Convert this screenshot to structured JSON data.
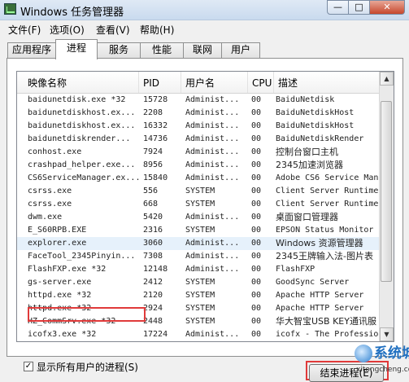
{
  "window": {
    "title": "Windows 任务管理器"
  },
  "titlebar_buttons": {
    "minimize": "—",
    "maximize": "□",
    "close": "✕"
  },
  "menu": [
    "文件(F)",
    "选项(O)",
    "查看(V)",
    "帮助(H)"
  ],
  "tabs": [
    "应用程序",
    "进程",
    "服务",
    "性能",
    "联网",
    "用户"
  ],
  "active_tab": "进程",
  "columns": [
    "映像名称",
    "PID",
    "用户名",
    "CPU",
    "描述"
  ],
  "processes": [
    {
      "name": "baidunetdisk.exe *32",
      "pid": "15728",
      "user": "Administ...",
      "cpu": "00",
      "desc": "BaiduNetdisk"
    },
    {
      "name": "baidunetdiskhost.ex...",
      "pid": "2208",
      "user": "Administ...",
      "cpu": "00",
      "desc": "BaiduNetdiskHost"
    },
    {
      "name": "baidunetdiskhost.ex...",
      "pid": "16332",
      "user": "Administ...",
      "cpu": "00",
      "desc": "BaiduNetdiskHost"
    },
    {
      "name": "baidunetdiskrender...",
      "pid": "14736",
      "user": "Administ...",
      "cpu": "00",
      "desc": "BaiduNetdiskRender"
    },
    {
      "name": "conhost.exe",
      "pid": "7924",
      "user": "Administ...",
      "cpu": "00",
      "desc": "控制台窗口主机"
    },
    {
      "name": "crashpad_helper.exe...",
      "pid": "8956",
      "user": "Administ...",
      "cpu": "00",
      "desc": "2345加速浏览器"
    },
    {
      "name": "CS6ServiceManager.ex...",
      "pid": "15840",
      "user": "Administ...",
      "cpu": "00",
      "desc": "Adobe CS6 Service Man"
    },
    {
      "name": "csrss.exe",
      "pid": "556",
      "user": "SYSTEM",
      "cpu": "00",
      "desc": "Client Server Runtime"
    },
    {
      "name": "csrss.exe",
      "pid": "668",
      "user": "SYSTEM",
      "cpu": "00",
      "desc": "Client Server Runtime"
    },
    {
      "name": "dwm.exe",
      "pid": "5420",
      "user": "Administ...",
      "cpu": "00",
      "desc": "桌面窗口管理器"
    },
    {
      "name": "E_S60RPB.EXE",
      "pid": "2316",
      "user": "SYSTEM",
      "cpu": "00",
      "desc": "EPSON Status Monitor"
    },
    {
      "name": "explorer.exe",
      "pid": "3060",
      "user": "Administ...",
      "cpu": "00",
      "desc": "Windows 资源管理器"
    },
    {
      "name": "FaceTool_2345Pinyin...",
      "pid": "7308",
      "user": "Administ...",
      "cpu": "00",
      "desc": "2345王牌输入法-图片表"
    },
    {
      "name": "FlashFXP.exe *32",
      "pid": "12148",
      "user": "Administ...",
      "cpu": "00",
      "desc": "FlashFXP"
    },
    {
      "name": "gs-server.exe",
      "pid": "2412",
      "user": "SYSTEM",
      "cpu": "00",
      "desc": "GoodSync Server"
    },
    {
      "name": "httpd.exe *32",
      "pid": "2120",
      "user": "SYSTEM",
      "cpu": "00",
      "desc": "Apache HTTP Server"
    },
    {
      "name": "httpd.exe *32",
      "pid": "2924",
      "user": "SYSTEM",
      "cpu": "00",
      "desc": "Apache HTTP Server"
    },
    {
      "name": "HZ_CommSrv.exe *32",
      "pid": "2448",
      "user": "SYSTEM",
      "cpu": "00",
      "desc": "华大智宝USB KEY通讯服"
    },
    {
      "name": "icofx3.exe *32",
      "pid": "17224",
      "user": "Administ...",
      "cpu": "00",
      "desc": "icofx - The Professio"
    }
  ],
  "selected_process": "explorer.exe",
  "show_all_users": {
    "checked": true,
    "label": "显示所有用户的进程(S)"
  },
  "end_process_button": "结束进程(E)",
  "watermark": {
    "text": "系统城",
    "sub": "xitongcheng.com"
  }
}
